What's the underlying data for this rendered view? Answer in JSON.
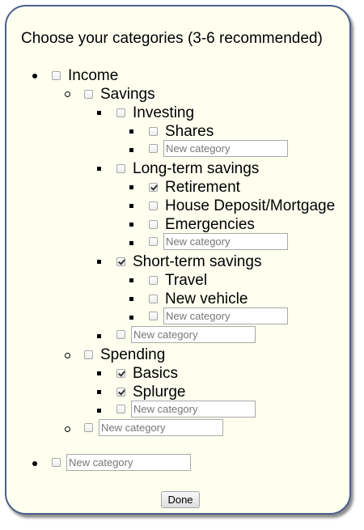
{
  "title": "Choose your categories (3-6 recommended)",
  "new_category_placeholder": "New category",
  "done_label": "Done",
  "tree": {
    "income": {
      "label": "Income",
      "checked": false
    },
    "savings": {
      "label": "Savings",
      "checked": false
    },
    "investing": {
      "label": "Investing",
      "checked": false
    },
    "shares": {
      "label": "Shares",
      "checked": false
    },
    "long_term_savings": {
      "label": "Long-term savings",
      "checked": false
    },
    "retirement": {
      "label": "Retirement",
      "checked": true
    },
    "house_deposit": {
      "label": "House Deposit/Mortgage",
      "checked": false
    },
    "emergencies": {
      "label": "Emergencies",
      "checked": false
    },
    "short_term_savings": {
      "label": "Short-term savings",
      "checked": true
    },
    "travel": {
      "label": "Travel",
      "checked": false
    },
    "new_vehicle": {
      "label": "New vehicle",
      "checked": false
    },
    "spending": {
      "label": "Spending",
      "checked": false
    },
    "basics": {
      "label": "Basics",
      "checked": true
    },
    "splurge": {
      "label": "Splurge",
      "checked": true
    }
  }
}
